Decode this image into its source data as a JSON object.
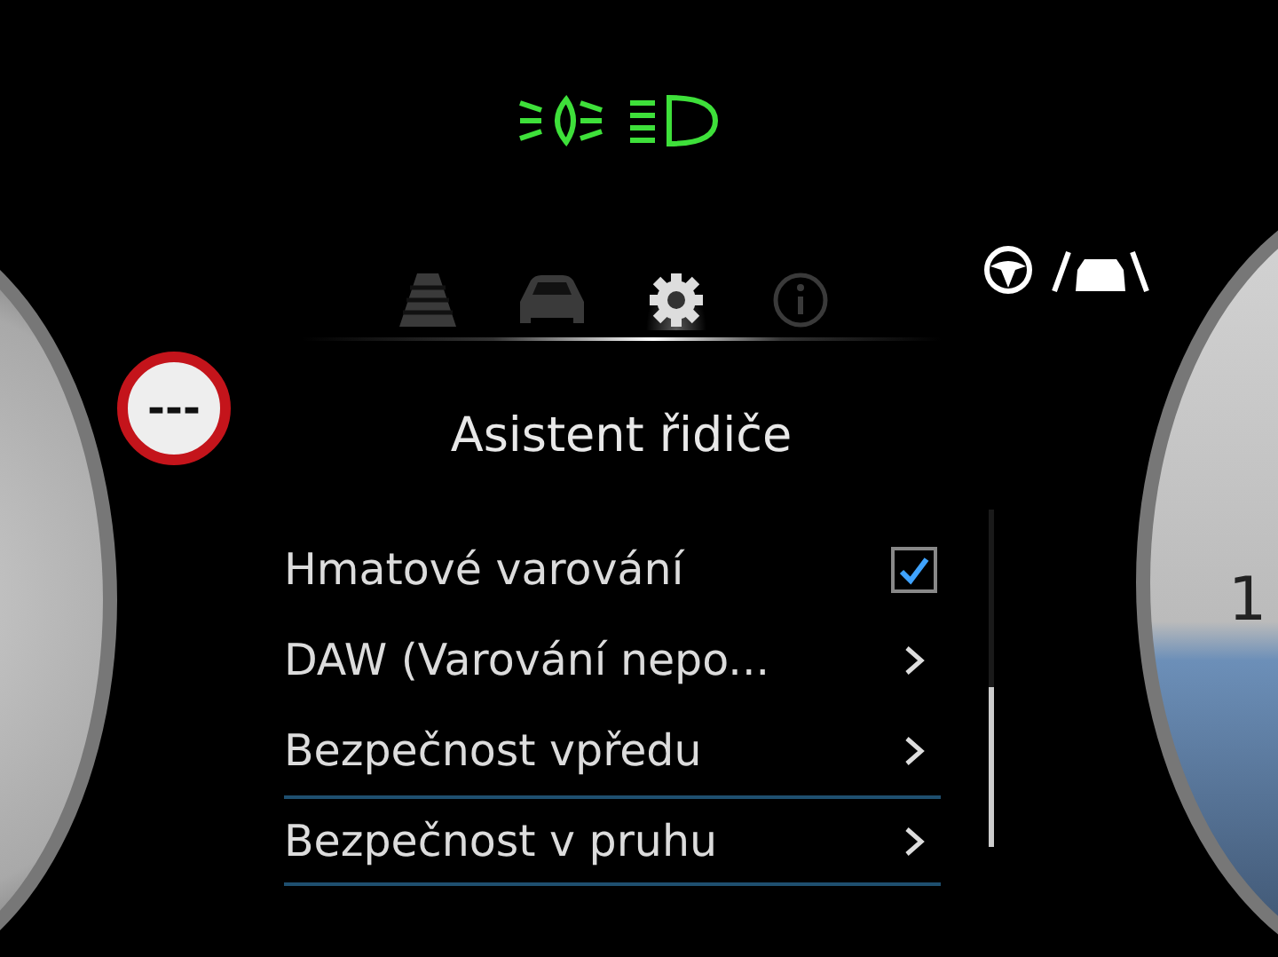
{
  "tabs": [
    {
      "kind": "lane",
      "selected": false
    },
    {
      "kind": "car",
      "selected": false
    },
    {
      "kind": "settings",
      "selected": true
    },
    {
      "kind": "info",
      "selected": false
    }
  ],
  "speed_limit": {
    "text": "---"
  },
  "title": "Asistent řidiče",
  "items": [
    {
      "kind": "checkbox",
      "label": "Hmatové varování",
      "checked": true,
      "selected": false
    },
    {
      "kind": "submenu",
      "label": "DAW (Varování nepo...",
      "selected": false
    },
    {
      "kind": "submenu",
      "label": "Bezpečnost vpředu",
      "selected": false
    },
    {
      "kind": "submenu",
      "label": "Bezpečnost v pruhu",
      "selected": true
    }
  ],
  "gauge_right": {
    "label": "1"
  }
}
